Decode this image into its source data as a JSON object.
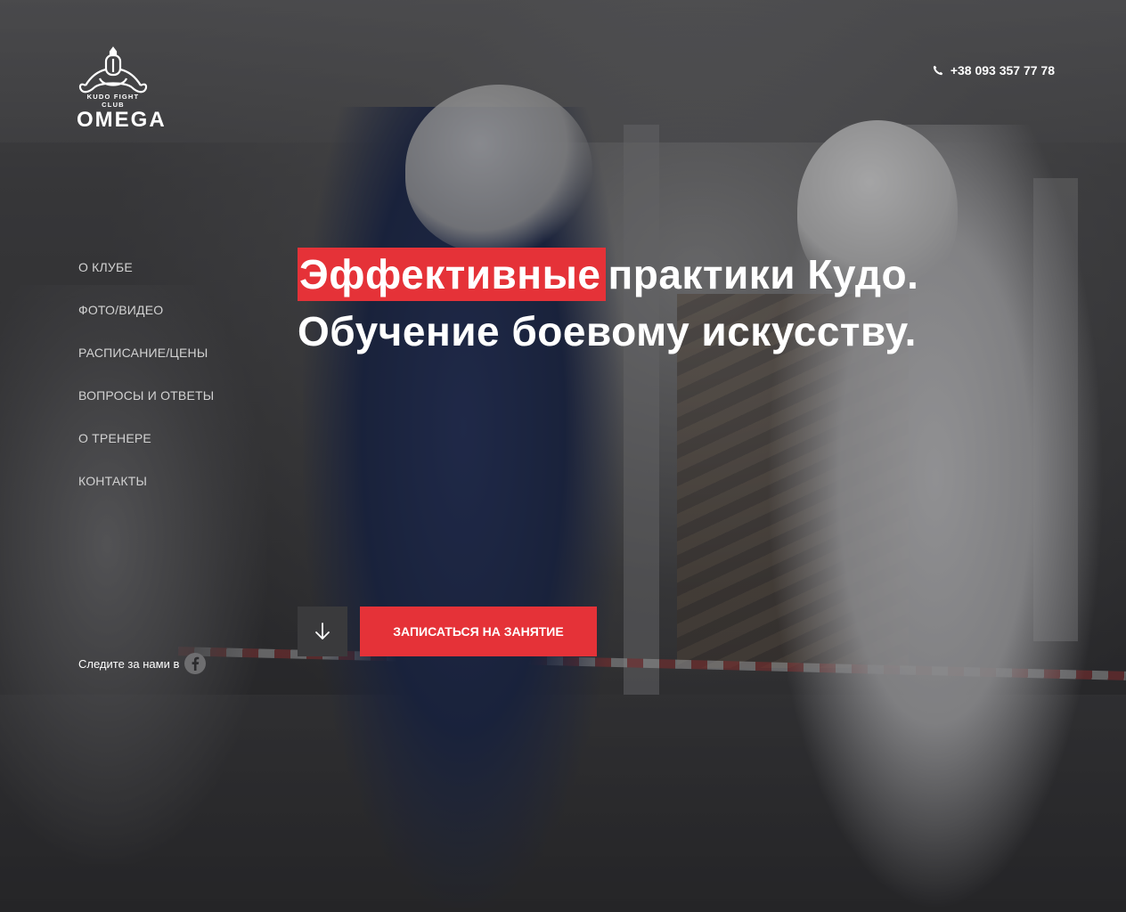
{
  "brand": {
    "logo_sub": "KUDO FIGHT CLUB",
    "logo_main": "OMEGA"
  },
  "header": {
    "phone": "+38 093 357 77 78",
    "phone_icon": "phone-icon"
  },
  "nav": {
    "items": [
      {
        "label": "О КЛУБЕ"
      },
      {
        "label": "ФОТО/ВИДЕО"
      },
      {
        "label": "РАСПИСАНИЕ/ЦЕНЫ"
      },
      {
        "label": "ВОПРОСЫ И ОТВЕТЫ"
      },
      {
        "label": "О ТРЕНЕРЕ"
      },
      {
        "label": "КОНТАКТЫ"
      }
    ]
  },
  "hero": {
    "headline_highlight": "Эффективные",
    "headline_rest": "практики Кудо. Обучение боевому искусству.",
    "scroll_icon": "arrow-down-icon",
    "cta_label": "ЗАПИСАТЬСЯ НА ЗАНЯТИЕ"
  },
  "social": {
    "follow_label": "Следите за нами в",
    "icon": "facebook-icon"
  },
  "colors": {
    "accent": "#e53238",
    "text": "#ffffff",
    "nav_text": "#d2d2d2"
  }
}
